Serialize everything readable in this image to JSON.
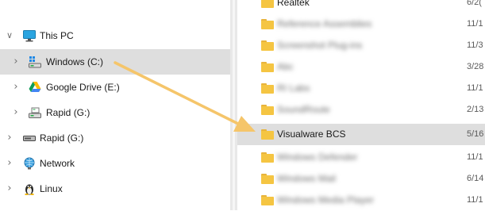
{
  "nav": {
    "items": [
      {
        "label": "This PC",
        "icon": "monitor-icon",
        "selected": false
      },
      {
        "label": "Windows (C:)",
        "icon": "windows-drive-icon",
        "selected": true
      },
      {
        "label": "Google Drive (E:)",
        "icon": "google-drive-icon",
        "selected": false
      },
      {
        "label": "Rapid (G:)",
        "icon": "drive-icon",
        "selected": false
      },
      {
        "label": "Rapid (G:)",
        "icon": "drive-icon",
        "selected": false
      },
      {
        "label": "Network",
        "icon": "network-icon",
        "selected": false
      },
      {
        "label": "Linux",
        "icon": "linux-penguin-icon",
        "selected": false
      }
    ],
    "expanded_chevron": "∨",
    "collapsed_chevron": "›"
  },
  "files": {
    "rows": [
      {
        "name": "Realtek",
        "date": "6/2(",
        "selected": false,
        "blurred": false
      },
      {
        "name": "Reference Assemblies",
        "date": "11/1",
        "selected": false,
        "blurred": true
      },
      {
        "name": "Screenshot Plug-ins",
        "date": "11/3",
        "selected": false,
        "blurred": true
      },
      {
        "name": "Abc",
        "date": "3/28",
        "selected": false,
        "blurred": true
      },
      {
        "name": "RI Labs",
        "date": "11/1",
        "selected": false,
        "blurred": true
      },
      {
        "name": "SoundRoute",
        "date": "2/13",
        "selected": false,
        "blurred": true
      },
      {
        "name": "Visualware BCS",
        "date": "5/16",
        "selected": true,
        "blurred": false
      },
      {
        "name": "Windows Defender",
        "date": "11/1",
        "selected": false,
        "blurred": true
      },
      {
        "name": "Windows Mail",
        "date": "6/14",
        "selected": false,
        "blurred": true
      },
      {
        "name": "Windows Media Player",
        "date": "11/1",
        "selected": false,
        "blurred": true
      }
    ]
  },
  "colors": {
    "arrow": "#f5c56a",
    "folder": "#f5c542",
    "selection": "#dedede"
  }
}
